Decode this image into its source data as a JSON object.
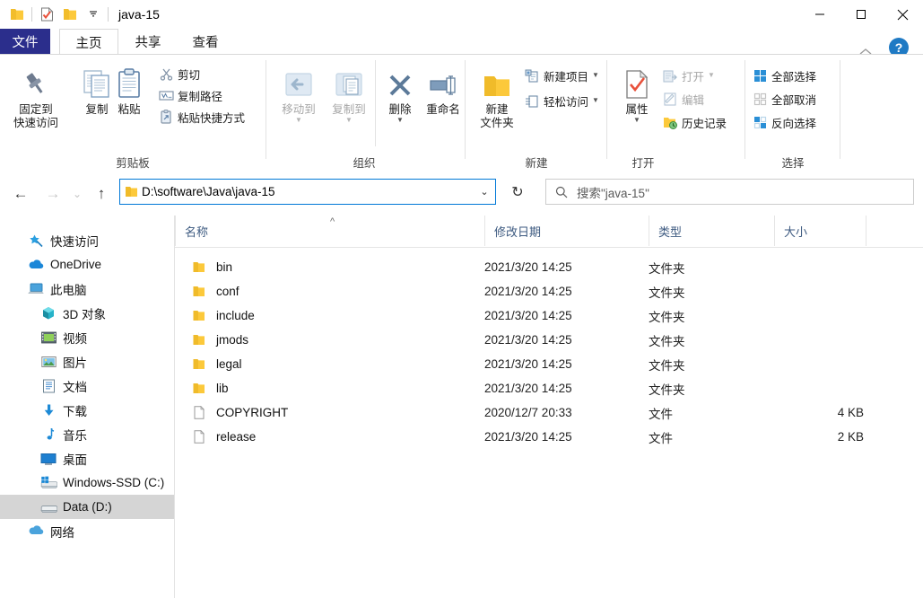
{
  "titlebar": {
    "title": "java-15",
    "quick_access": [
      {
        "name": "folder-icon",
        "label": "属性"
      },
      {
        "name": "properties-icon",
        "label": "属性"
      },
      {
        "name": "new-folder-icon",
        "label": "新建文件夹"
      },
      {
        "name": "chevron-down-icon",
        "label": "自定义快速访问工具栏"
      }
    ],
    "minimize": "—",
    "maximize": "▢",
    "close": "✕"
  },
  "tabs": [
    {
      "label": "文件",
      "active": false,
      "kind": "file"
    },
    {
      "label": "主页",
      "active": true,
      "kind": "normal"
    },
    {
      "label": "共享",
      "active": false,
      "kind": "normal"
    },
    {
      "label": "查看",
      "active": false,
      "kind": "normal"
    }
  ],
  "ribbon": {
    "collapse_label": "^",
    "help_label": "?",
    "groups": [
      {
        "name": "clipboard",
        "label": "剪贴板",
        "big_buttons": [
          {
            "name": "pin-to-quick-access-button",
            "label": "固定到\n快速访问",
            "icon": "pin-icon"
          },
          {
            "name": "copy-button",
            "label": "复制",
            "icon": "copy-icon"
          },
          {
            "name": "paste-button",
            "label": "粘贴",
            "icon": "paste-icon"
          }
        ],
        "small_buttons": [
          {
            "name": "cut-button",
            "label": "剪切",
            "icon": "scissors-icon",
            "disabled": false
          },
          {
            "name": "copy-path-button",
            "label": "复制路径",
            "icon": "copy-path-icon",
            "disabled": false
          },
          {
            "name": "paste-shortcut-button",
            "label": "粘贴快捷方式",
            "icon": "paste-shortcut-icon",
            "disabled": false
          }
        ]
      },
      {
        "name": "organize",
        "label": "组织",
        "big_buttons": [
          {
            "name": "move-to-button",
            "label": "移动到",
            "icon": "move-to-icon",
            "disabled": true,
            "caret": true
          },
          {
            "name": "copy-to-button",
            "label": "复制到",
            "icon": "copy-to-icon",
            "disabled": true,
            "caret": true
          },
          {
            "name": "delete-button",
            "label": "删除",
            "icon": "delete-x-icon",
            "disabled": false,
            "caret": true
          },
          {
            "name": "rename-button",
            "label": "重命名",
            "icon": "rename-icon",
            "disabled": false
          }
        ]
      },
      {
        "name": "new",
        "label": "新建",
        "big_buttons": [
          {
            "name": "new-folder-button",
            "label": "新建\n文件夹",
            "icon": "new-folder-icon"
          }
        ],
        "small_buttons": [
          {
            "name": "new-item-button",
            "label": "新建项目",
            "icon": "new-item-icon",
            "caret": true
          },
          {
            "name": "easy-access-button",
            "label": "轻松访问",
            "icon": "easy-access-icon",
            "caret": true
          }
        ]
      },
      {
        "name": "open",
        "label": "打开",
        "big_buttons": [
          {
            "name": "properties-button",
            "label": "属性",
            "icon": "properties-check-icon",
            "caret": true
          }
        ],
        "small_buttons": [
          {
            "name": "open-button",
            "label": "打开",
            "icon": "open-icon",
            "disabled": true,
            "caret": true
          },
          {
            "name": "edit-button",
            "label": "编辑",
            "icon": "edit-icon",
            "disabled": true
          },
          {
            "name": "history-button",
            "label": "历史记录",
            "icon": "history-icon",
            "disabled": false
          }
        ]
      },
      {
        "name": "select",
        "label": "选择",
        "small_buttons": [
          {
            "name": "select-all-button",
            "label": "全部选择",
            "icon": "select-all-icon"
          },
          {
            "name": "select-none-button",
            "label": "全部取消",
            "icon": "select-none-icon"
          },
          {
            "name": "invert-selection-button",
            "label": "反向选择",
            "icon": "invert-selection-icon"
          }
        ]
      }
    ]
  },
  "navbar": {
    "back": "←",
    "forward": "→",
    "recent": "⌄",
    "up": "↑",
    "address_value": "D:\\software\\Java\\java-15",
    "address_dropdown": "⌄",
    "refresh": "↻",
    "search_placeholder": "搜索\"java-15\""
  },
  "navpane": {
    "items": [
      {
        "label": "快速访问",
        "icon": "star-pin-icon",
        "level": 0,
        "selected": false
      },
      {
        "label": "OneDrive",
        "icon": "onedrive-cloud-icon",
        "level": 0,
        "selected": false
      },
      {
        "label": "此电脑",
        "icon": "this-pc-icon",
        "level": 0,
        "selected": false
      },
      {
        "label": "3D 对象",
        "icon": "3d-objects-icon",
        "level": 1,
        "selected": false
      },
      {
        "label": "视频",
        "icon": "videos-icon",
        "level": 1,
        "selected": false
      },
      {
        "label": "图片",
        "icon": "pictures-icon",
        "level": 1,
        "selected": false
      },
      {
        "label": "文档",
        "icon": "documents-icon",
        "level": 1,
        "selected": false
      },
      {
        "label": "下载",
        "icon": "downloads-icon",
        "level": 1,
        "selected": false
      },
      {
        "label": "音乐",
        "icon": "music-icon",
        "level": 1,
        "selected": false
      },
      {
        "label": "桌面",
        "icon": "desktop-icon",
        "level": 1,
        "selected": false
      },
      {
        "label": "Windows-SSD (C:)",
        "icon": "windows-drive-icon",
        "level": 1,
        "selected": false
      },
      {
        "label": "Data (D:)",
        "icon": "drive-icon",
        "level": 1,
        "selected": true
      },
      {
        "label": "网络",
        "icon": "network-icon",
        "level": 0,
        "selected": false
      }
    ]
  },
  "filelist": {
    "columns": [
      {
        "label": "名称",
        "key": "name"
      },
      {
        "label": "修改日期",
        "key": "date"
      },
      {
        "label": "类型",
        "key": "type"
      },
      {
        "label": "大小",
        "key": "size"
      }
    ],
    "sort_indicator": "^",
    "rows": [
      {
        "name": "bin",
        "date": "2021/3/20 14:25",
        "type": "文件夹",
        "size": "",
        "icon": "folder-icon"
      },
      {
        "name": "conf",
        "date": "2021/3/20 14:25",
        "type": "文件夹",
        "size": "",
        "icon": "folder-icon"
      },
      {
        "name": "include",
        "date": "2021/3/20 14:25",
        "type": "文件夹",
        "size": "",
        "icon": "folder-icon"
      },
      {
        "name": "jmods",
        "date": "2021/3/20 14:25",
        "type": "文件夹",
        "size": "",
        "icon": "folder-icon"
      },
      {
        "name": "legal",
        "date": "2021/3/20 14:25",
        "type": "文件夹",
        "size": "",
        "icon": "folder-icon"
      },
      {
        "name": "lib",
        "date": "2021/3/20 14:25",
        "type": "文件夹",
        "size": "",
        "icon": "folder-icon"
      },
      {
        "name": "COPYRIGHT",
        "date": "2020/12/7 20:33",
        "type": "文件",
        "size": "4 KB",
        "icon": "file-icon"
      },
      {
        "name": "release",
        "date": "2021/3/20 14:25",
        "type": "文件",
        "size": "2 KB",
        "icon": "file-icon"
      }
    ]
  },
  "colors": {
    "file_tab_bg": "#2b2e8c",
    "accent_blue": "#0078d7",
    "folder_yellow": "#fcc93b",
    "header_text": "#3d5a80",
    "selection_gray": "#d5d5d5"
  }
}
